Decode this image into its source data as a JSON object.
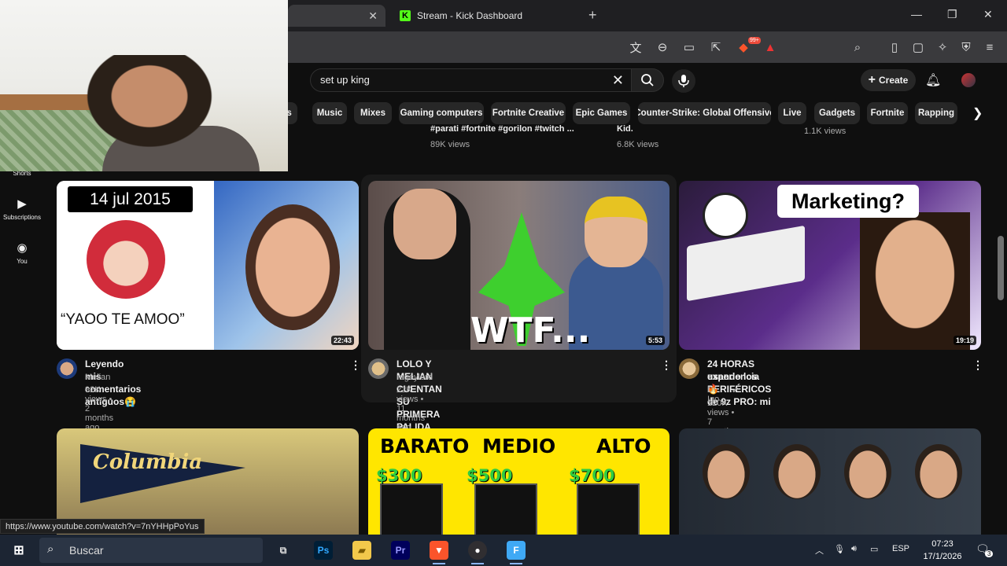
{
  "browser": {
    "tabs": [
      {
        "label": "",
        "active": true
      },
      {
        "label": "Stream - Kick Dashboard",
        "active": false
      }
    ],
    "brave_badge": "99+"
  },
  "youtube": {
    "search": {
      "value": "set up king"
    },
    "create_label": "Create",
    "chips": [
      "es",
      "Music",
      "Mixes",
      "Gaming computers",
      "Fortnite Creative",
      "Epic Games",
      "Counter-Strike: Global Offensive",
      "Live",
      "Gadgets",
      "Fortnite",
      "Rapping"
    ],
    "sidebar": [
      {
        "label": "Shorts",
        "icon": "shorts-icon"
      },
      {
        "label": "Subscriptions",
        "icon": "subscriptions-icon"
      },
      {
        "label": "You",
        "icon": "you-icon"
      }
    ],
    "prev_row": [
      {
        "title": "#parati #fortnite #gorilon #twitch ...",
        "views": "89K views"
      },
      {
        "title": "Kid.",
        "views": "6.8K views"
      },
      {
        "views": "1.1K views"
      }
    ],
    "videos": [
      {
        "title": "Leyendo mis comentarios antiguos😭",
        "channel": "Melian",
        "stats": "92K views • 2 months ago",
        "duration": "22:43",
        "thumb_date": "14 jul 2015",
        "thumb_quote": "“YAOO TE AMOO”"
      },
      {
        "title": "LOLO Y MELIAN CUENTAN SU PRIMERA PALIDA",
        "channel": "rageylord",
        "stats": "22K views • 11 months ago",
        "duration": "5:53",
        "thumb_text": "WTF..."
      },
      {
        "title_line1": "24 HORAS usando los PERIFÉRICOS de 9z PRO: mi",
        "title_line2": "experiencia🔥",
        "channel": "Dr Igo",
        "stats": "120K views • 7 months ago",
        "duration": "19:19",
        "thumb_text": "Marketing?"
      }
    ],
    "row2": {
      "t4_text": "Columbia",
      "t5_labels": [
        "BARATO",
        "MEDIO",
        "ALTO"
      ],
      "t5_prices": [
        "$300",
        "$500",
        "$700"
      ]
    }
  },
  "status_url": "https://www.youtube.com/watch?v=7nYHHpPoYus",
  "taskbar": {
    "search_placeholder": "Buscar",
    "lang": "ESP",
    "time": "07:23",
    "date": "17/1/2026",
    "notifications": "3"
  },
  "colors": {
    "kick": "#53fc18",
    "yt_bg": "#0f0f0f",
    "chip_bg": "#272727"
  }
}
